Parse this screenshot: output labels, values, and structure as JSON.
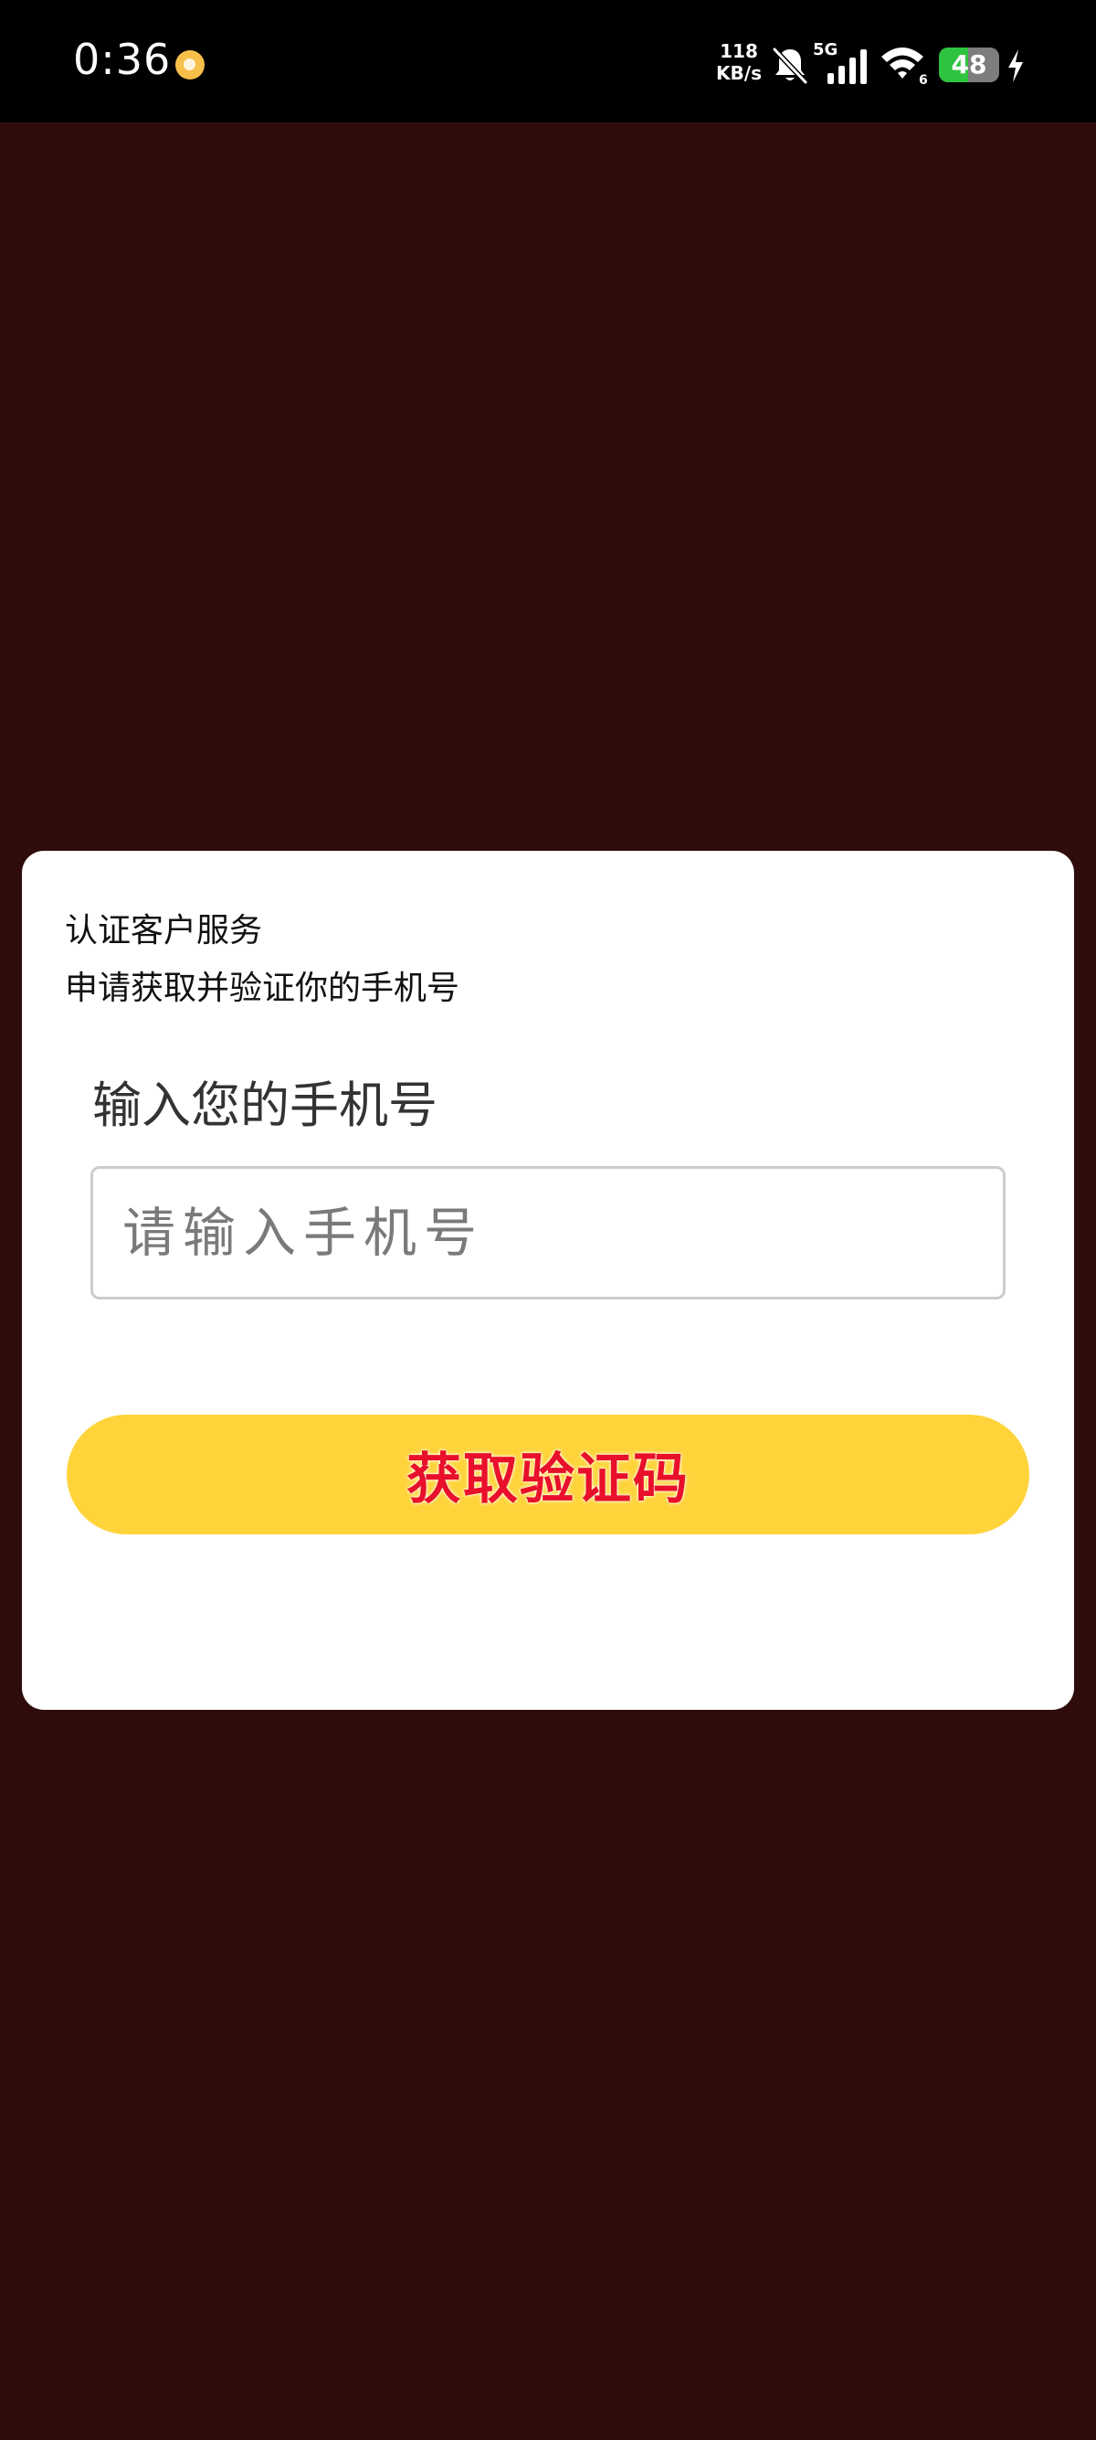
{
  "status_bar": {
    "time": "0:36",
    "app_indicator": "app-notification-icon",
    "net_speed_value": "118",
    "net_speed_unit": "KB/s",
    "network_type": "5G",
    "wifi_level": "6",
    "battery_percent": "48",
    "battery_level": 48,
    "colors": {
      "background": "#000000",
      "battery_fill": "#2fc43f"
    },
    "icons": [
      "app-notification-icon",
      "bell-off-icon",
      "signal-icon",
      "wifi-icon",
      "battery-icon",
      "charging-bolt-icon"
    ]
  },
  "card": {
    "title": "认证客户服务",
    "description": "申请获取并验证你的手机号",
    "phone_label": "输入您的手机号",
    "phone_input": {
      "value": "",
      "placeholder": "请输入手机号"
    },
    "get_code_button": "获取验证码"
  },
  "colors": {
    "page_background": "#2f0c0c",
    "card_background": "#ffffff",
    "button_background": "#ffd43b",
    "button_text": "#e8102a"
  }
}
